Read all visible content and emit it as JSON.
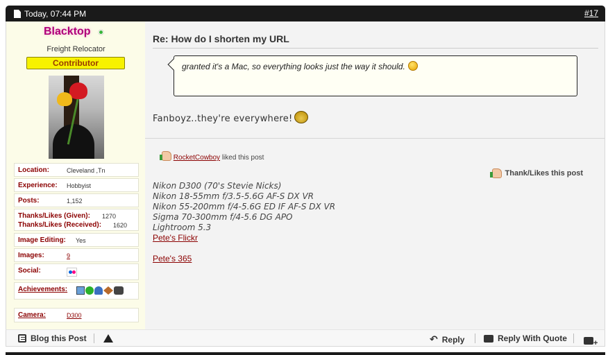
{
  "post": {
    "date": "Today, 07:44 PM",
    "number": "#17",
    "title": "Re: How do I shorten my URL",
    "quote": "granted it's a Mac, so everything looks just the way it should.",
    "body": "Fanboyz..they're everywhere!"
  },
  "user": {
    "name": "Blacktop",
    "title": "Freight Relocator",
    "rank": "Contributor",
    "location_label": "Location:",
    "location": "Cleveland ,Tn",
    "experience_label": "Experience:",
    "experience": "Hobbyist",
    "posts_label": "Posts:",
    "posts": "1,152",
    "thanks_given_label": "Thanks/Likes (Given):",
    "thanks_given": "1270",
    "thanks_received_label": "Thanks/Likes (Received):",
    "thanks_received": "1620",
    "image_editing_label": "Image Editing:",
    "image_editing": "Yes",
    "images_label": "Images:",
    "images": "9",
    "social_label": "Social:",
    "achievements_label": "Achievements:",
    "camera_label": "Camera:",
    "camera": "D300"
  },
  "likes": {
    "liker": "RocketCowboy",
    "liked_text": "liked this post",
    "thanks_button": "Thank/Likes this post"
  },
  "signature": {
    "lines": [
      "Nikon D300 (70's Stevie Nicks)",
      "Nikon 18-55mm f/3.5-5.6G AF-S DX VR",
      "Nikon 55-200mm f/4-5.6G ED IF AF-S DX VR",
      "Sigma 70-300mm f/4-5.6 DG APO",
      "Lightroom 5.3"
    ],
    "link1": "Pete's Flickr",
    "link2": "Pete's 365"
  },
  "footer": {
    "blog": "Blog this Post",
    "reply": "Reply",
    "reply_quote": "Reply With Quote"
  },
  "icons": [
    "document-icon",
    "online-status-icon",
    "smiley-icon",
    "fanboy-smiley-icon",
    "thumbs-up-icon",
    "flickr-icon",
    "blog-icon",
    "report-warning-icon",
    "reply-arrow-icon",
    "reply-quote-icon",
    "multi-quote-icon"
  ],
  "colors": {
    "username": "#b0007a",
    "rank_bg": "#f7f200",
    "label": "#8b0000",
    "header_bg": "#1a1a1a",
    "panel_bg": "#fcfce8"
  }
}
